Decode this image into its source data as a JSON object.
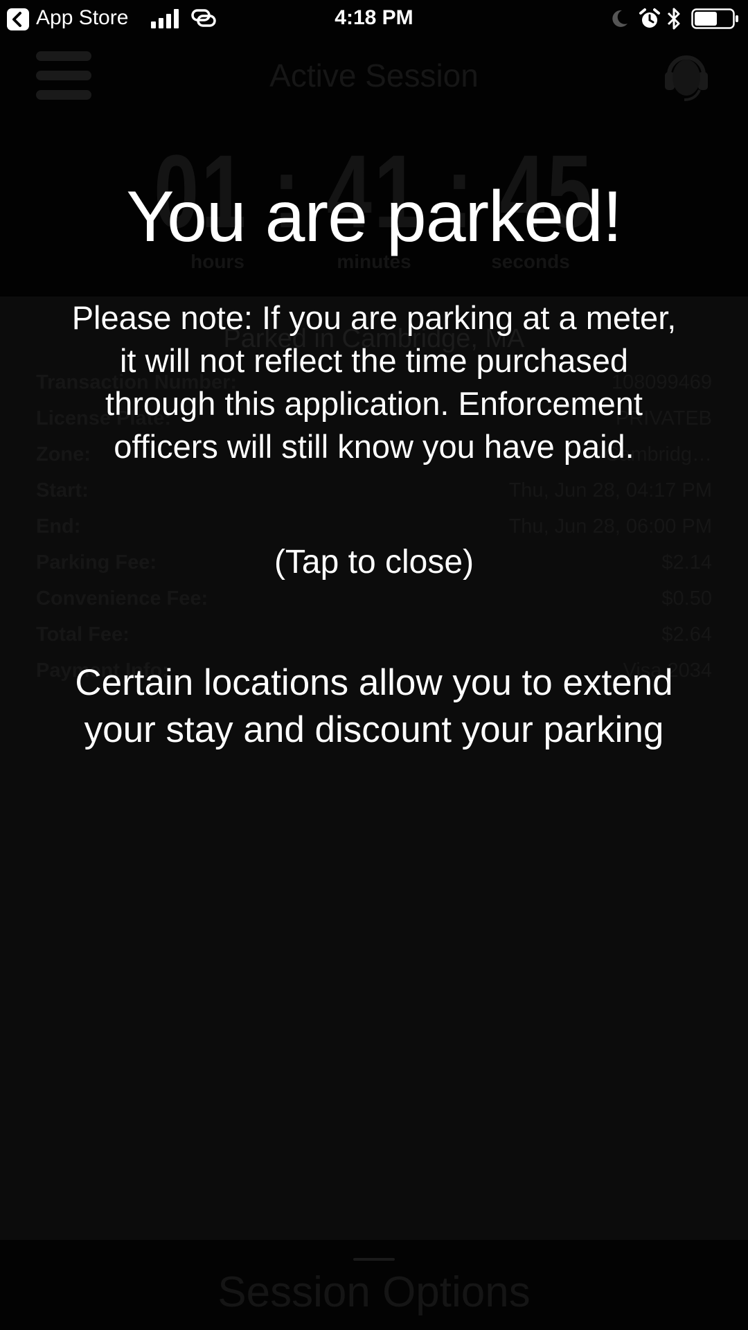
{
  "status_bar": {
    "back_app": "App Store",
    "time": "4:18 PM",
    "icons": [
      "back-chevron-icon",
      "signal-icon",
      "link-icon",
      "moon-icon",
      "alarm-icon",
      "bluetooth-icon",
      "battery-icon"
    ]
  },
  "app": {
    "title": "Active Session",
    "timer": {
      "value": "01 : 41 : 45",
      "hours_label": "hours",
      "minutes_label": "minutes",
      "seconds_label": "seconds"
    },
    "location": "Parked in Cambridge, MA",
    "details": [
      {
        "label": "Transaction Number:",
        "value": "108099469"
      },
      {
        "label": "License Plate:",
        "value": "PRIVATEB"
      },
      {
        "label": "Zone:",
        "value": "Cambridg…"
      },
      {
        "label": "Start:",
        "value": "Thu, Jun 28, 04:17 PM"
      },
      {
        "label": "End:",
        "value": "Thu, Jun 28, 06:00 PM"
      },
      {
        "label": "Parking Fee:",
        "value": "$2.14"
      },
      {
        "label": "Convenience Fee:",
        "value": "$0.50"
      },
      {
        "label": "Total Fee:",
        "value": "$2.64"
      },
      {
        "label": "Payment Info:",
        "value": "Visa 2034"
      }
    ],
    "session_options": "Session Options"
  },
  "overlay": {
    "title": "You are parked!",
    "note": "Please note:  If you are parking at a meter,\nit will not reflect the time purchased\nthrough this application. Enforcement\nofficers will still know you have paid.",
    "close": "(Tap to close)",
    "extend": "Certain locations allow you to extend\nyour stay and discount your parking"
  },
  "colors": {
    "overlay_text": "#ffffff",
    "background": "#0c0c0c",
    "dimmed_content": "#161616"
  }
}
